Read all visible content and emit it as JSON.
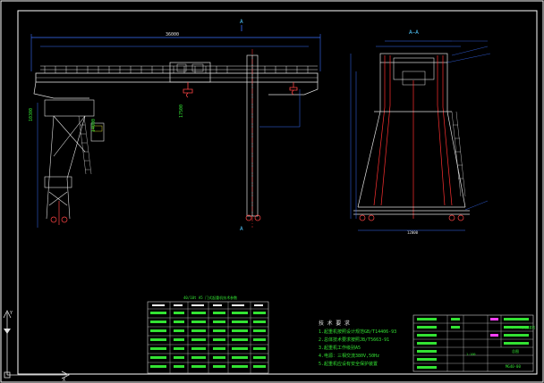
{
  "drawing": {
    "background": "#000000",
    "colors": {
      "frame": "#ffffff",
      "girder": "#e0e0e0",
      "dimension": "#3a6fff",
      "centerline": "#ff3030",
      "hook": "#ff4444",
      "text_green": "#33e233",
      "text_cyan": "#4fc3f7",
      "table_line": "#cfcfcf",
      "magenta": "#ff40ff",
      "yellow": "#ffff33"
    },
    "front_view": {
      "section_mark_top": "A",
      "section_mark_bottom": "A",
      "overall_dimension": "36000",
      "left_height_dim": "10300",
      "right_height_dim": "14000",
      "span_dim": "17500"
    },
    "side_view": {
      "section_title": "A—A",
      "bottom_dimension": "12000"
    },
    "notes": {
      "title": "技 术 要 求",
      "lines": [
        "1.起重机按照设计规范GB/T14406-93",
        "2.总体技术要求按照JB/T5663-91",
        "3.起重机工作级别A5",
        "4.电源：三相交流380V,50Hz",
        "5.起重机应设有安全保护装置"
      ]
    },
    "parameter_table": {
      "title": "40/10t  A5 门式起重机技术参数",
      "columns": [
        "项目",
        "单位",
        "数值",
        "项目",
        "单位",
        "数值",
        "备注"
      ]
    },
    "title_block": {
      "drawing_name": "40/10t门式起重机",
      "drawing_type": "总图",
      "drawing_no": "MG40-00",
      "scale": "1:100"
    },
    "icons": [
      "ucs-axis-icon"
    ]
  }
}
